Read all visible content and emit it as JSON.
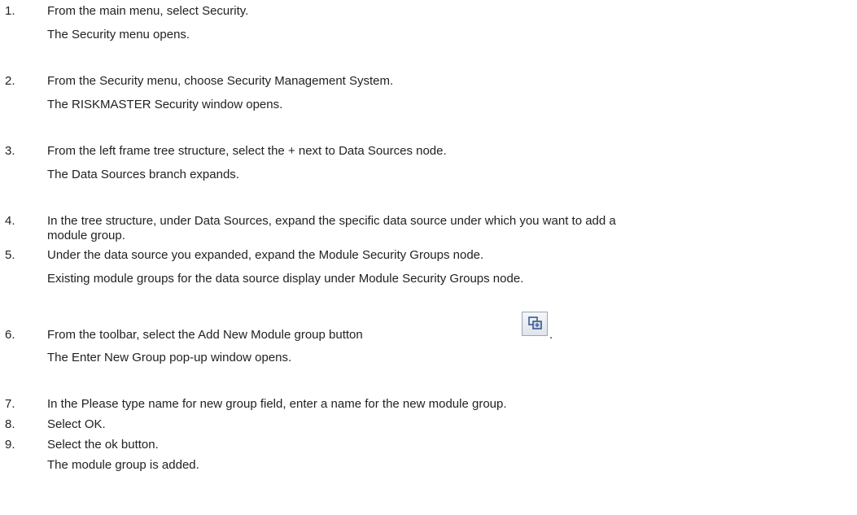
{
  "steps": [
    {
      "num": "1.",
      "text": "From the main menu, select Security.",
      "result": "The Security menu opens."
    },
    {
      "num": "2.",
      "text": "From the Security menu, choose Security Management System.",
      "result": "The RISKMASTER Security window opens."
    },
    {
      "num": "3.",
      "text": "From the left frame tree structure, select the + next to Data Sources node.",
      "result": "The Data Sources branch expands."
    },
    {
      "num": "4.",
      "text_line1": "In the tree structure, under Data Sources, expand the specific data source under which you want to add a",
      "text_line2": "module group."
    },
    {
      "num": "5.",
      "text": "Under the data source you expanded, expand the Module Security Groups node.",
      "result": "Existing module groups for the data source display under Module Security Groups node."
    },
    {
      "num": "6.",
      "text_before_icon": "From the toolbar, select the Add New Module group button",
      "text_after_icon": ".",
      "icon": "add-module-group-icon",
      "result": "The Enter New Group pop-up window opens."
    },
    {
      "num": "7.",
      "text": "In the Please type name for new group field, enter a name for the new module group."
    },
    {
      "num": "8.",
      "text": "Select OK."
    },
    {
      "num": "9.",
      "text": "Select the ok button.",
      "result": "The module group is added."
    }
  ]
}
